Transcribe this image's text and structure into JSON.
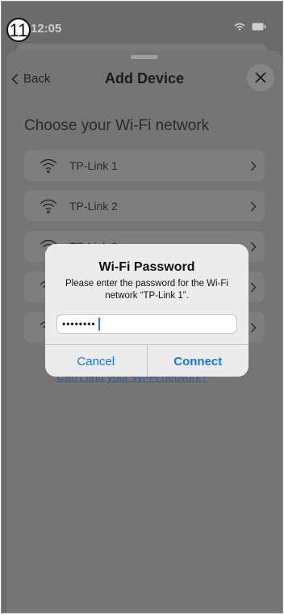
{
  "status": {
    "step": "11",
    "time": "12:05"
  },
  "nav": {
    "back_label": "Back",
    "title": "Add Device"
  },
  "page": {
    "heading": "Choose your Wi-Fi network",
    "cant_find_link": "Can't find your Wi-Fi network?"
  },
  "networks": [
    {
      "name": "TP-Link 1"
    },
    {
      "name": "TP-Link 2"
    },
    {
      "name": "TP-Link 3"
    },
    {
      "name": ""
    },
    {
      "name": ""
    }
  ],
  "dialog": {
    "title": "Wi-Fi Password",
    "message": "Please enter the password for the Wi-Fi network “TP-Link 1”.",
    "password_masked": "••••••••",
    "cancel_label": "Cancel",
    "connect_label": "Connect"
  },
  "colors": {
    "accent": "#1877d6",
    "overlay": "#6b6b6b"
  }
}
